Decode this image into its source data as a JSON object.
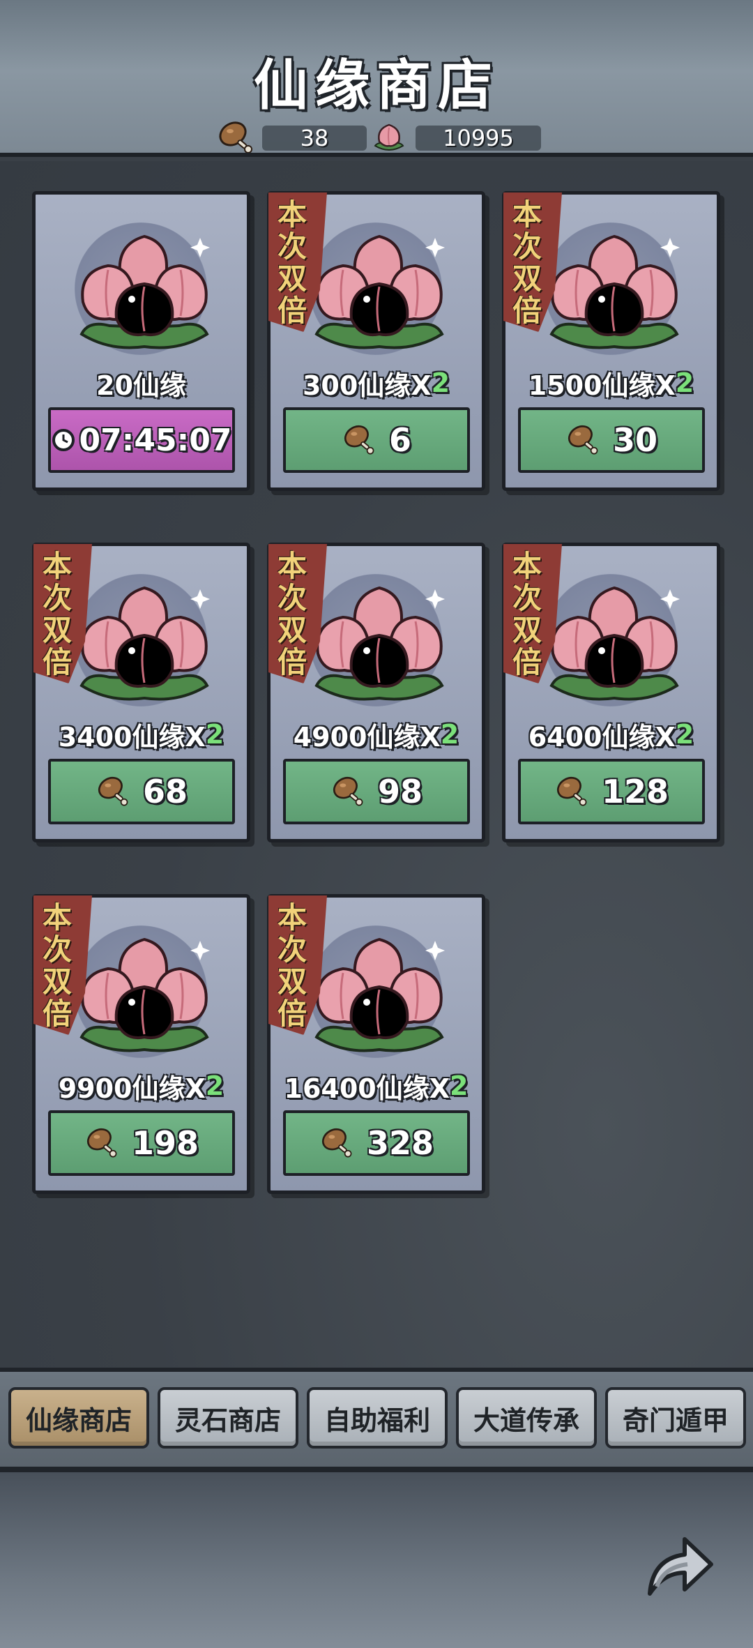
{
  "header": {
    "title": "仙缘商店",
    "drumsticks": "38",
    "peaches": "10995"
  },
  "shop_items": [
    {
      "label": "20仙缘",
      "multiplier": "",
      "double_badge": "",
      "price": "07:45:07",
      "price_type": "timer"
    },
    {
      "label": "300仙缘X",
      "multiplier": "2",
      "double_badge": "本次双倍",
      "price": "6",
      "price_type": "drumstick"
    },
    {
      "label": "1500仙缘X",
      "multiplier": "2",
      "double_badge": "本次双倍",
      "price": "30",
      "price_type": "drumstick"
    },
    {
      "label": "3400仙缘X",
      "multiplier": "2",
      "double_badge": "本次双倍",
      "price": "68",
      "price_type": "drumstick"
    },
    {
      "label": "4900仙缘X",
      "multiplier": "2",
      "double_badge": "本次双倍",
      "price": "98",
      "price_type": "drumstick"
    },
    {
      "label": "6400仙缘X",
      "multiplier": "2",
      "double_badge": "本次双倍",
      "price": "128",
      "price_type": "drumstick"
    },
    {
      "label": "9900仙缘X",
      "multiplier": "2",
      "double_badge": "本次双倍",
      "price": "198",
      "price_type": "drumstick"
    },
    {
      "label": "16400仙缘X",
      "multiplier": "2",
      "double_badge": "本次双倍",
      "price": "328",
      "price_type": "drumstick"
    }
  ],
  "tabs": [
    {
      "label": "仙缘商店",
      "active": true
    },
    {
      "label": "灵石商店",
      "active": false
    },
    {
      "label": "自助福利",
      "active": false
    },
    {
      "label": "大道传承",
      "active": false
    },
    {
      "label": "奇门遁甲",
      "active": false
    }
  ],
  "icons": {
    "currency_1": "drumstick-icon",
    "currency_2": "peach-icon",
    "timer": "clock-icon",
    "share": "share-arrow-icon"
  },
  "colors": {
    "buy_button": "#5d9e72",
    "timer_button": "#ad54ab",
    "double_ribbon": "#8e3b35",
    "multiplier_text": "#7be07a"
  }
}
